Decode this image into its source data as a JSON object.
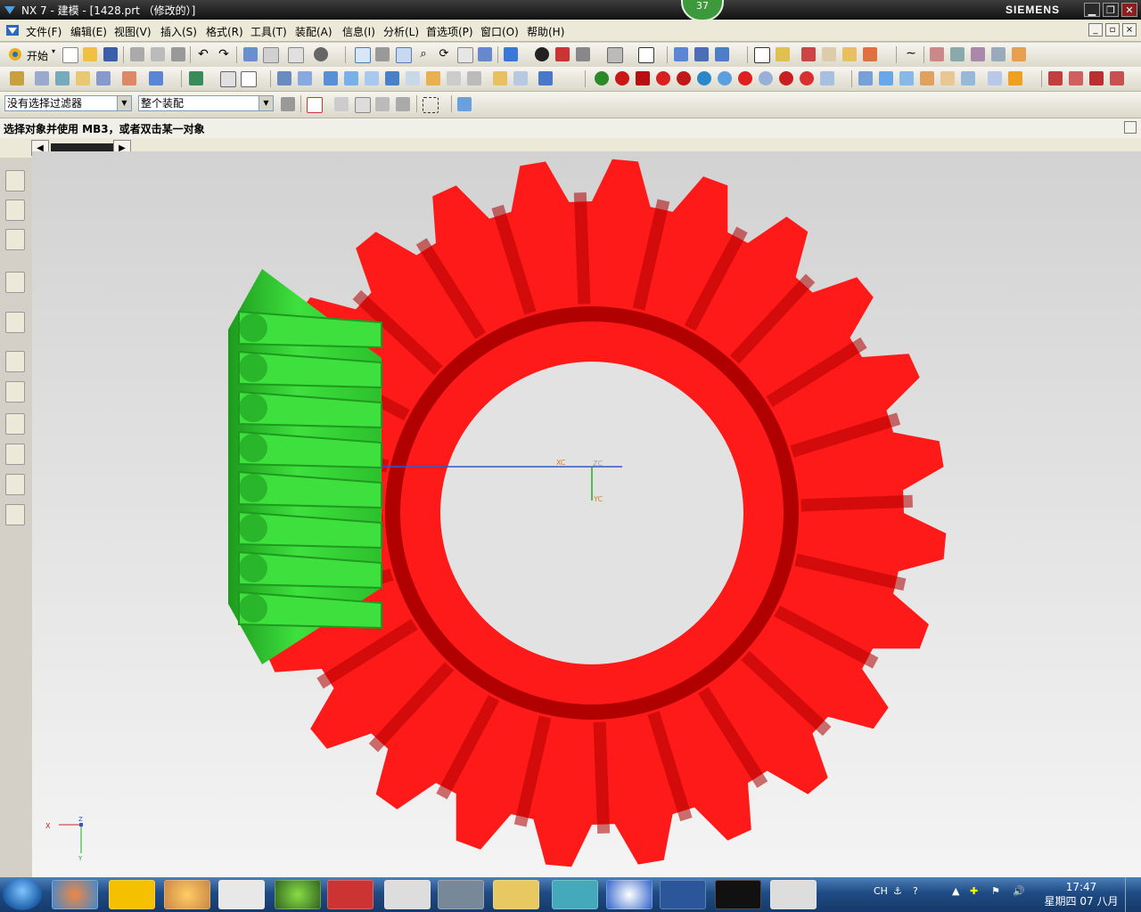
{
  "window": {
    "title": "NX 7 - 建模 - [1428.prt （修改的）]",
    "brand": "SIEMENS",
    "badge": "37",
    "min": "▁",
    "max": "❐",
    "close": "✕"
  },
  "menu": [
    "文件(F)",
    "编辑(E)",
    "视图(V)",
    "插入(S)",
    "格式(R)",
    "工具(T)",
    "装配(A)",
    "信息(I)",
    "分析(L)",
    "首选项(P)",
    "窗口(O)",
    "帮助(H)"
  ],
  "toolbar": {
    "start_label": "开始",
    "filter_value": "没有选择过滤器",
    "scope_value": "整个装配"
  },
  "cue_line": "选择对象并使用 MB3，或者双击某一对象",
  "viewport": {
    "wcs_labels": {
      "xc": "XC",
      "zc": "ZC",
      "yc": "YC"
    },
    "triad_labels": {
      "x": "X",
      "z": "Z",
      "y": "Y"
    },
    "colors": {
      "ring_gear": "#ff1a1a",
      "ring_gear_shadow": "#b00000",
      "pinion": "#3ee03e",
      "pinion_shadow": "#1e9a1e"
    }
  },
  "tray": {
    "lang": "CH",
    "time": "17:47",
    "date": "星期四 07 八月"
  },
  "icons": [
    "nx-logo-icon",
    "start-orb-icon",
    "new-file-icon",
    "open-icon",
    "save-icon",
    "undo-icon",
    "redo-icon",
    "fit-view-icon",
    "rotate-icon",
    "shaded-icon",
    "selection-filter-icon",
    "volume-icon",
    "clock-icon"
  ]
}
